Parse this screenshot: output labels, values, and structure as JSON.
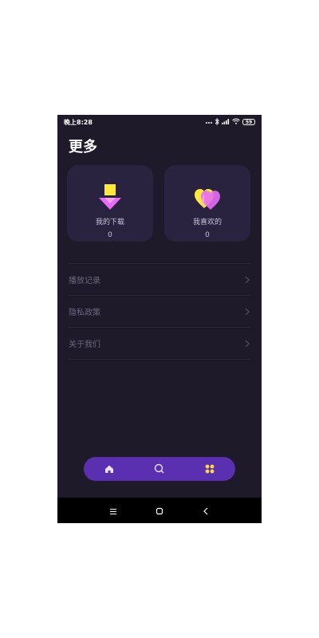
{
  "status_bar": {
    "time": "晚上8:28",
    "indicators": [
      "dots-icon",
      "bluetooth-icon",
      "signal-icon",
      "wifi-icon"
    ],
    "battery": "59"
  },
  "header": {
    "title": "更多"
  },
  "cards": [
    {
      "label": "我的下载",
      "count": "0",
      "icon": "download-arrow-icon",
      "colors": [
        "#ffe93b",
        "#e76cf5"
      ]
    },
    {
      "label": "我喜欢的",
      "count": "0",
      "icon": "hearts-icon",
      "colors": [
        "#ffe93b",
        "#e76cf5"
      ]
    }
  ],
  "menu": {
    "items": [
      {
        "label": "播放记录"
      },
      {
        "label": "隐私政策"
      },
      {
        "label": "关于我们"
      }
    ]
  },
  "tabbar": {
    "tabs": [
      {
        "icon": "home-icon"
      },
      {
        "icon": "search-icon"
      },
      {
        "icon": "more-grid-icon"
      }
    ],
    "background": "#5a2fb0",
    "active_color": "#ffd64a"
  },
  "navbar": {
    "buttons": [
      "menu-icon",
      "home-square-icon",
      "back-icon"
    ]
  }
}
